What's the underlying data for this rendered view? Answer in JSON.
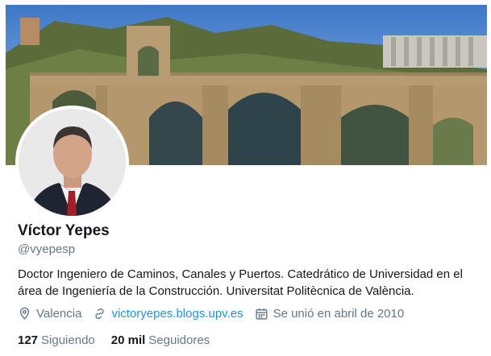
{
  "profile": {
    "name": "Víctor Yepes",
    "handle": "@vyepesp",
    "bio": "Doctor Ingeniero de Caminos, Canales y Puertos. Catedrático de Universidad en el área de Ingeniería de la Construcción. Universitat Politècnica de València.",
    "location": "Valencia",
    "website": "victoryepes.blogs.upv.es",
    "joined": "Se unió en abril de 2010"
  },
  "stats": {
    "following_count": "127",
    "following_label": "Siguiendo",
    "followers_count": "20 mil",
    "followers_label": "Seguidores"
  },
  "icons": {
    "location": "location-pin-icon",
    "link": "link-icon",
    "calendar": "calendar-icon"
  },
  "colors": {
    "text": "#14171a",
    "secondary": "#657786",
    "link": "#1b95e0"
  }
}
